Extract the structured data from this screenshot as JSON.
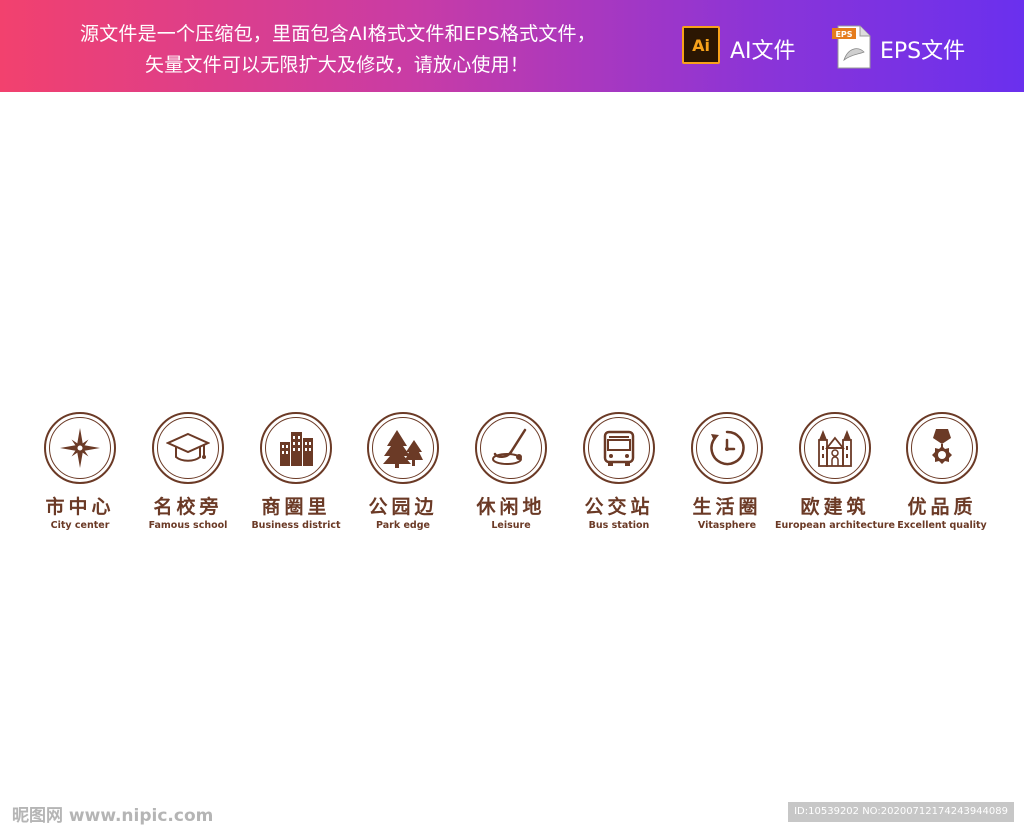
{
  "banner": {
    "line1": "源文件是一个压缩包，里面包含AI格式文件和EPS格式文件，",
    "line2": "矢量文件可以无限扩大及修改，请放心使用！",
    "ai_badge": "Ai",
    "ai_label": "AI文件",
    "eps_badge": "EPS",
    "eps_label": "EPS文件"
  },
  "icons": [
    {
      "zh": "市中心",
      "en": "City center",
      "icon": "compass-icon"
    },
    {
      "zh": "名校旁",
      "en": "Famous school",
      "icon": "graduation-cap-icon"
    },
    {
      "zh": "商圈里",
      "en": "Business district",
      "icon": "buildings-icon"
    },
    {
      "zh": "公园边",
      "en": "Park edge",
      "icon": "trees-icon"
    },
    {
      "zh": "休闲地",
      "en": "Leisure",
      "icon": "golf-icon"
    },
    {
      "zh": "公交站",
      "en": "Bus station",
      "icon": "bus-icon"
    },
    {
      "zh": "生活圈",
      "en": "Vitasphere",
      "icon": "clock-icon"
    },
    {
      "zh": "欧建筑",
      "en": "European architecture",
      "icon": "cathedral-icon"
    },
    {
      "zh": "优品质",
      "en": "Excellent quality",
      "icon": "medal-icon"
    }
  ],
  "watermark": {
    "left": "昵图网 www.nipic.com",
    "right": "ID:10539202 NO:20200712174243944089"
  },
  "colors": {
    "icon_brown": "#6b3a26",
    "banner_start": "#f2416e",
    "banner_end": "#6a30ee"
  }
}
